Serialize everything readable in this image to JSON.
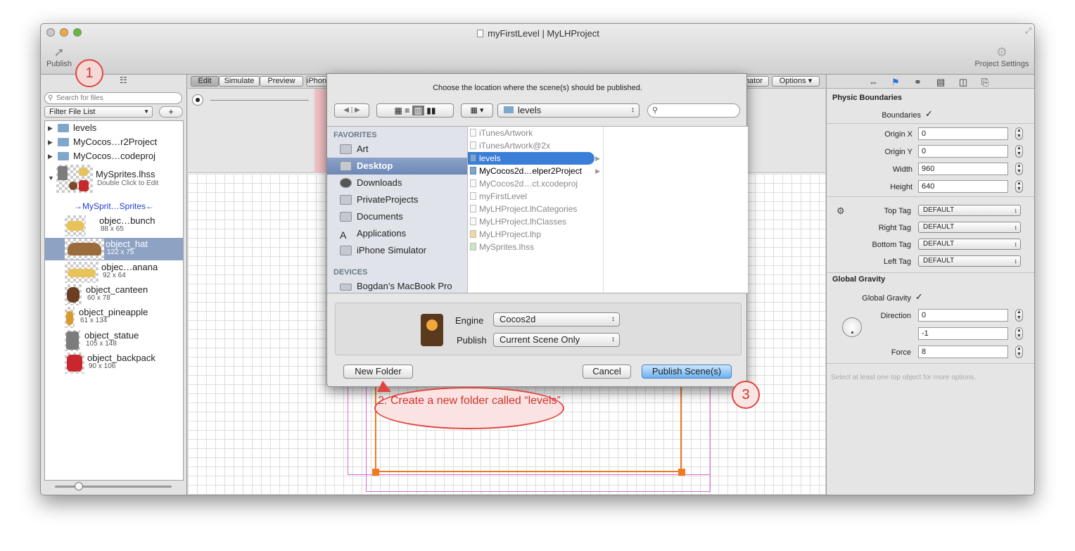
{
  "window": {
    "title": "myFirstLevel | MyLHProject"
  },
  "toolbar": {
    "publish": "Publish",
    "project_settings": "Project Settings"
  },
  "sidebar": {
    "search_placeholder": "Search for files",
    "filter": "Filter File List",
    "add": "+",
    "tree": [
      {
        "label": "levels"
      },
      {
        "label": "MyCocos…r2Project"
      },
      {
        "label": "MyCocos…codeproj"
      }
    ],
    "spritesheet": {
      "name": "MySprites.lhss",
      "hint": "Double Click to Edit",
      "group": "→MySprit…Sprites←"
    },
    "sprites": [
      {
        "name": "objec…bunch",
        "size": "88 x 65"
      },
      {
        "name": "object_hat",
        "size": "122 x 75"
      },
      {
        "name": "objec…anana",
        "size": "92 x 64"
      },
      {
        "name": "object_canteen",
        "size": "60 x 78"
      },
      {
        "name": "object_pineapple",
        "size": "61 x 134"
      },
      {
        "name": "object_statue",
        "size": "105 x 148"
      },
      {
        "name": "object_backpack",
        "size": "90 x 106"
      }
    ]
  },
  "modes": {
    "edit": "Edit",
    "simulate": "Simulate",
    "preview": "Preview",
    "device": "iPhone",
    "animator": "Animator",
    "options": "Options"
  },
  "dialog": {
    "prompt": "Choose the location where the scene(s) should be published.",
    "location": "levels",
    "favorites_header": "FAVORITES",
    "favorites": [
      "Art",
      "Desktop",
      "Downloads",
      "PrivateProjects",
      "Documents",
      "Applications",
      "iPhone Simulator"
    ],
    "devices_header": "DEVICES",
    "devices": [
      "Bogdan’s MacBook Pro"
    ],
    "files": [
      "iTunesArtwork",
      "iTunesArtwork@2x",
      "levels",
      "MyCocos2d…elper2Project",
      "MyCocos2d…ct.xcodeproj",
      "myFirstLevel",
      "MyLHProject.lhCategories",
      "MyLHProject.lhClasses",
      "MyLHProject.lhp",
      "MySprites.lhss"
    ],
    "engine_label": "Engine",
    "engine_value": "Cocos2d",
    "publish_label": "Publish",
    "publish_value": "Current Scene Only",
    "new_folder": "New Folder",
    "cancel": "Cancel",
    "publish_button": "Publish Scene(s)"
  },
  "inspector": {
    "physic_boundaries": "Physic Boundaries",
    "boundaries": "Boundaries",
    "origin_x_label": "Origin X",
    "origin_x": "0",
    "origin_y_label": "Origin Y",
    "origin_y": "0",
    "width_label": "Width",
    "width": "960",
    "height_label": "Height",
    "height": "640",
    "top_tag_label": "Top Tag",
    "top_tag": "DEFAULT",
    "right_tag_label": "Right Tag",
    "right_tag": "DEFAULT",
    "bottom_tag_label": "Bottom Tag",
    "bottom_tag": "DEFAULT",
    "left_tag_label": "Left Tag",
    "left_tag": "DEFAULT",
    "global_gravity_header": "Global Gravity",
    "global_gravity": "Global Gravity",
    "direction_label": "Direction",
    "direction_x": "0",
    "direction_y": "-1",
    "force_label": "Force",
    "force": "8",
    "hint": "Select at least one top object for more options."
  },
  "callouts": {
    "one": "1",
    "two": "2. Create a new folder called “levels”",
    "three": "3"
  },
  "colors": {
    "callout": "#e0453f",
    "selection": "#3b7ed8",
    "boundary": "#f07a20",
    "boundary2": "#d96ad6"
  }
}
